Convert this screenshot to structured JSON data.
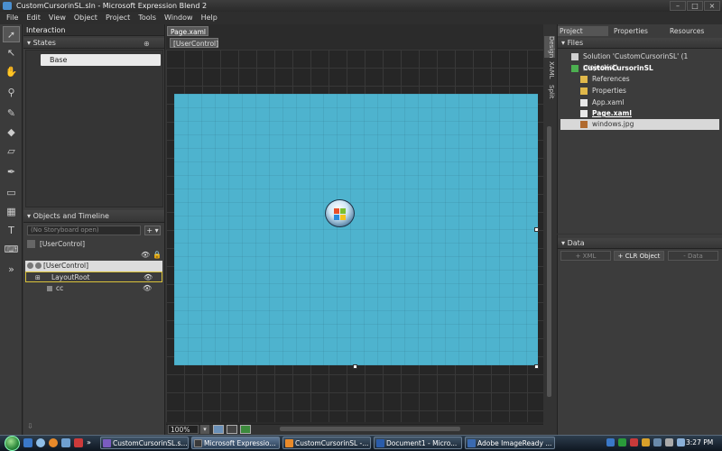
{
  "window": {
    "title": "CustomCursorinSL.sln - Microsoft Expression Blend 2"
  },
  "menu": [
    "File",
    "Edit",
    "View",
    "Object",
    "Project",
    "Tools",
    "Window",
    "Help"
  ],
  "interaction": {
    "title": "Interaction",
    "states_label": "States",
    "base_state": "Base"
  },
  "objects": {
    "title": "Objects and Timeline",
    "storyboard": "(No Storyboard open)",
    "scope": "[UserControl]",
    "tree": [
      "[UserControl]",
      "LayoutRoot",
      "cc"
    ]
  },
  "document": {
    "tab": "Page.xaml",
    "breadcrumb": "[UserControl]",
    "zoom": "100%",
    "side_tabs": [
      "Design",
      "XAML",
      "Split"
    ]
  },
  "project_panel": {
    "tabs": [
      "Project",
      "Properties",
      "Resources"
    ],
    "files_label": "Files",
    "files": [
      "Solution 'CustomCursorinSL' (1 project(s))",
      "CustomCursorinSL",
      "References",
      "Properties",
      "App.xaml",
      "Page.xaml",
      "windows.jpg"
    ]
  },
  "data_panel": {
    "title": "Data",
    "buttons": [
      "+ XML",
      "+ CLR Object",
      "- Data"
    ]
  },
  "taskbar": {
    "items": [
      "CustomCursorinSL.s...",
      "Microsoft Expressio...",
      "CustomCursorinSL -...",
      "Document1 - Micro...",
      "Adobe ImageReady ..."
    ],
    "clock": "3:27 PM"
  },
  "colors": {
    "artboard": "#4eb3ce",
    "chrome": "#3c3c3c"
  }
}
